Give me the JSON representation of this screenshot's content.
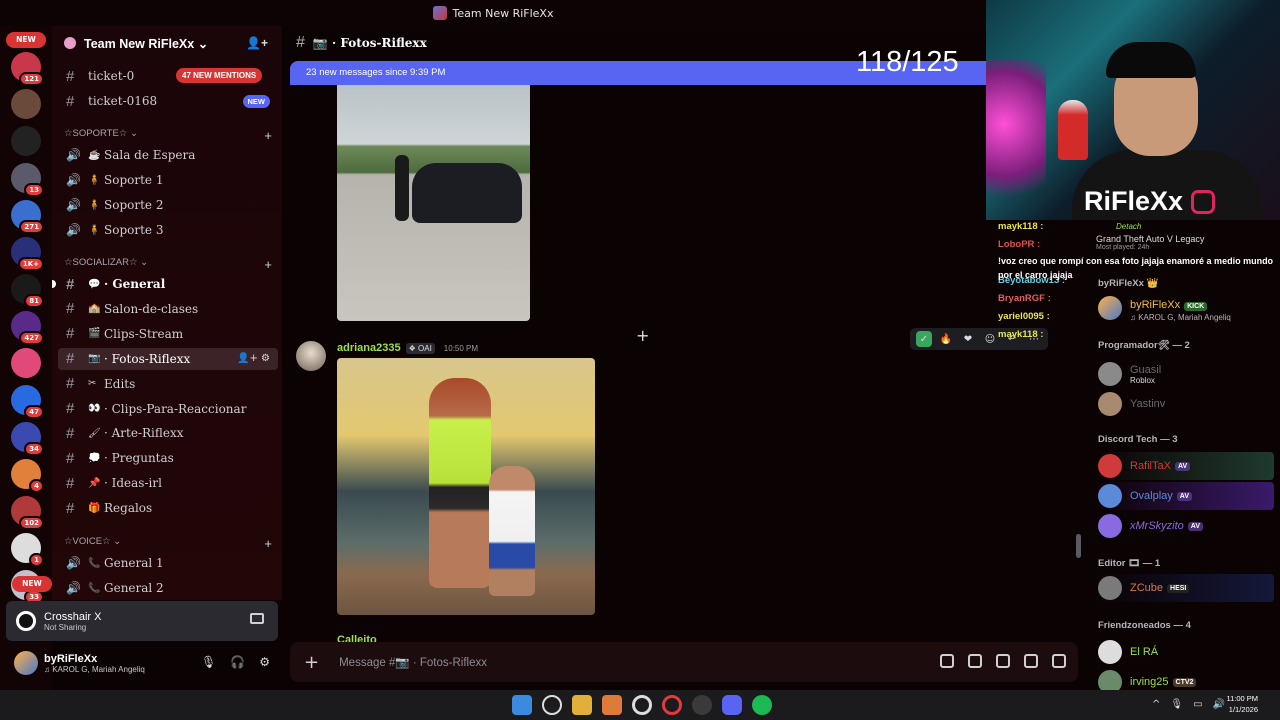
{
  "window_title": "Team New RiFleXx",
  "servers": [
    {
      "badge": "121",
      "color": "#c9384a"
    },
    {
      "badge": "",
      "color": "#6a4a3a"
    },
    {
      "badge": "",
      "color": "#222222"
    },
    {
      "badge": "13",
      "color": "#5a5a6a"
    },
    {
      "badge": "271",
      "color": "#3a6fd0"
    },
    {
      "badge": "1K+",
      "color": "#2a2f7a"
    },
    {
      "badge": "81",
      "color": "#1a1a1a"
    },
    {
      "badge": "427",
      "color": "#5a2a8a"
    },
    {
      "badge": "",
      "color": "#e04a7a"
    },
    {
      "badge": "47",
      "color": "#2a6ae0"
    },
    {
      "badge": "34",
      "color": "#3a4ab0"
    },
    {
      "badge": "4",
      "color": "#e0803a"
    },
    {
      "badge": "102",
      "color": "#b03a3a"
    },
    {
      "badge": "1",
      "color": "#ddd"
    },
    {
      "badge": "33",
      "color": "#c0c0d0"
    }
  ],
  "rail": {
    "new_top": "NEW",
    "new_bottom": "NEW"
  },
  "guild": {
    "name": "Team New RiFleXx ⌄"
  },
  "channels_top": {
    "ticket_partial": "ticket-0",
    "mentions": "47 NEW MENTIONS",
    "ticket_0168": "ticket-0168",
    "new_badge": "NEW"
  },
  "categories": {
    "soporte": "☆SOPORTE☆ ⌄",
    "socializar": "☆SOCIALIZAR☆ ⌄",
    "voice": "☆VOICE☆ ⌄"
  },
  "voice_support": [
    {
      "emoji": "☕",
      "label": "Sala de Espera"
    },
    {
      "emoji": "🧍",
      "label": "Soporte 1"
    },
    {
      "emoji": "🧍",
      "label": "Soporte 2"
    },
    {
      "emoji": "🧍",
      "label": "Soporte 3"
    }
  ],
  "text_channels": [
    {
      "emoji": "💬",
      "label": "· General",
      "bold": true
    },
    {
      "emoji": "🏫",
      "label": "Salon-de-clases"
    },
    {
      "emoji": "🎬",
      "label": "Clips-Stream"
    },
    {
      "emoji": "📷",
      "label": "· Fotos-Riflexx",
      "selected": true
    },
    {
      "emoji": "✂",
      "label": "Edits"
    },
    {
      "emoji": "👀",
      "label": "· Clips-Para-Reaccionar"
    },
    {
      "emoji": "🖌",
      "label": "· Arte-Riflexx"
    },
    {
      "emoji": "💭",
      "label": "· Preguntas"
    },
    {
      "emoji": "📌",
      "label": "· Ideas-irl"
    },
    {
      "emoji": "🎁",
      "label": "Regalos"
    }
  ],
  "voice_channels": [
    {
      "emoji": "📞",
      "label": "General 1"
    },
    {
      "emoji": "📞",
      "label": "General 2"
    }
  ],
  "activity": {
    "title": "Crosshair X",
    "status": "Not Sharing"
  },
  "user": {
    "name": "byRiFleXx",
    "status": "♫ KAROL G, Mariah Angeliq"
  },
  "chat": {
    "channel": "📷 · Fotos-Riflexx",
    "new_messages": "23 new messages since 9:39 PM",
    "counter": "118/125",
    "message_author": "adriana2335",
    "message_tag": "❖ OAI",
    "message_time": "10:50 PM",
    "next_author": "Calleito",
    "composer_placeholder": "Message #📷 · Fotos-Riflexx"
  },
  "stream": {
    "brand": "RiFleXx",
    "chat_lines": [
      {
        "name": "mayk118 :",
        "color": "#e8e650"
      },
      {
        "name": "LoboPR :",
        "color": "#e05050"
      },
      {
        "name": "Beyotabow13 :",
        "color": "#60d0e0"
      },
      {
        "name": "BryanRGF :",
        "color": "#e06060"
      },
      {
        "name": "yariel0095 :",
        "color": "#e8e650"
      },
      {
        "name": "mayk118 :",
        "color": "#e8e650"
      }
    ],
    "overlay_message": "!voz creo que rompí con esa foto jajaja enamoré a medio mundo por el carro jajaja"
  },
  "game": {
    "title": "Grand Theft Auto V Legacy",
    "played": "Most played: 24h",
    "detach": "Detach"
  },
  "members": {
    "owner_header": "byRiFleXx 👑",
    "owner_name": "byRiFleXx",
    "owner_tag": "KICK",
    "owner_status": "♫ KAROL G, Mariah Angeliq",
    "programador_header": "Programador🛠 — 2",
    "programador": [
      {
        "name": "Guasil",
        "status": "Roblox"
      },
      {
        "name": "Yastinv",
        "status": ""
      }
    ],
    "tech_header": "Discord Tech — 3",
    "tech": [
      {
        "name": "RafilTaX",
        "tag": "AV",
        "color": "#d03a3a"
      },
      {
        "name": "Ovalplay",
        "tag": "AV",
        "color": "#5a8ad8"
      },
      {
        "name": "xMrSkyzito",
        "tag": "AV",
        "color": "#8a6ae0"
      }
    ],
    "editor_header": "Editor 🎞 — 1",
    "editor": {
      "name": "ZCube",
      "tag": "HESI"
    },
    "friendzone_header": "Friendzoneados — 4",
    "friendzone": [
      {
        "name": "El RÁ",
        "tag": ""
      },
      {
        "name": "irving25",
        "tag": "CTV2"
      }
    ]
  },
  "clock": {
    "time": "11:00 PM",
    "date": "1/1/2026"
  }
}
